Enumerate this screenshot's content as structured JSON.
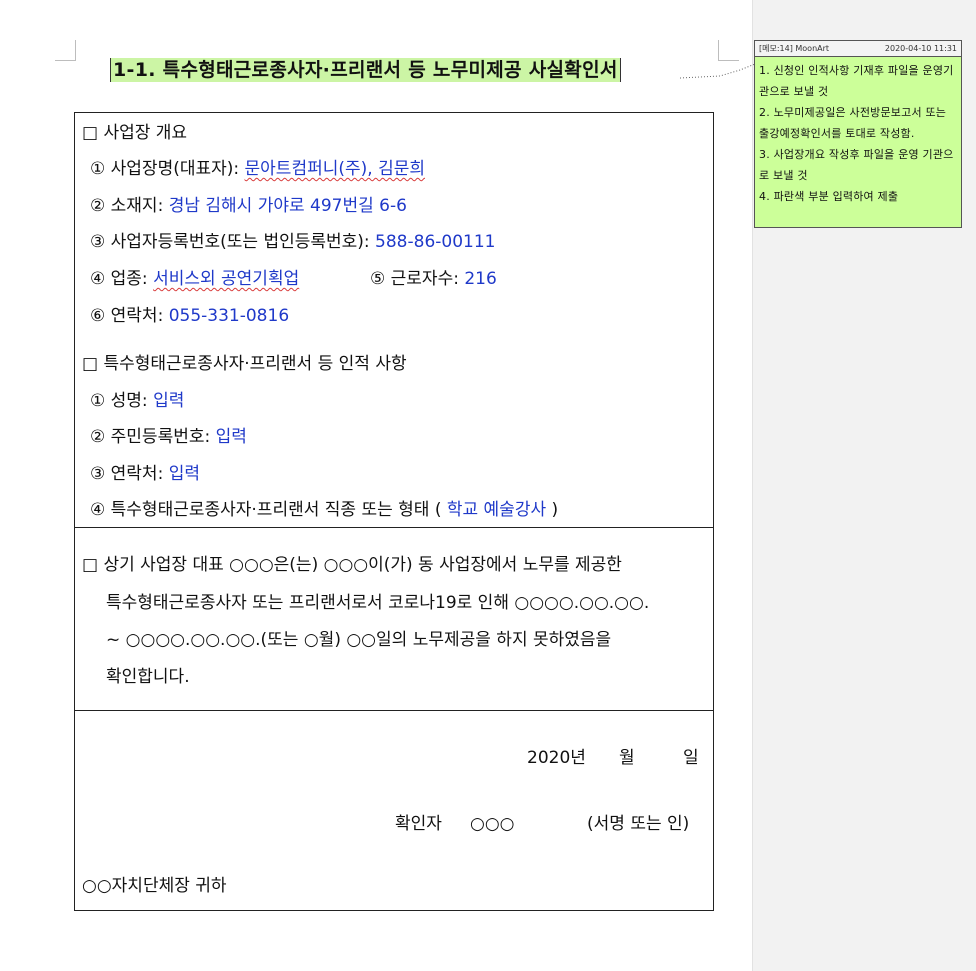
{
  "title": {
    "text": "1-1. 특수형태근로종사자·프리랜서 등 노무미제공 사실확인서"
  },
  "section1": {
    "heading": "□ 사업장 개요",
    "items": [
      {
        "label": "① 사업장명(대표자): ",
        "value": "문아트컴퍼니(주), 김문희"
      },
      {
        "label": "② 소재지: ",
        "value": "경남 김해시 가야로 497번길 6-6"
      },
      {
        "label": "③ 사업자등록번호(또는 법인등록번호): ",
        "value": "588-86-00111"
      },
      {
        "label": "④ 업종: ",
        "value": "서비스외 공연기획업"
      },
      {
        "label": "⑤ 근로자수: ",
        "value": "216"
      },
      {
        "label": "⑥ 연락처: ",
        "value": "055-331-0816"
      }
    ]
  },
  "section2": {
    "heading": "□ 특수형태근로종사자·프리랜서 등 인적 사항",
    "items": [
      {
        "label": "① 성명: ",
        "value": "입력"
      },
      {
        "label": "② 주민등록번호: ",
        "value": "입력"
      },
      {
        "label": "③ 연락처: ",
        "value": "입력"
      },
      {
        "label": "④ 특수형태근로종사자·프리랜서 직종 또는 형태 ( ",
        "value": "학교 예술강사",
        "suffix": " )"
      }
    ]
  },
  "statement": {
    "lines": [
      "□ 상기 사업장 대표 ○○○은(는) ○○○이(가) 동 사업장에서 노무를 제공한",
      "특수형태근로종사자 또는 프리랜서로서 코로나19로 인해 ○○○○.○○.○○.",
      "~ ○○○○.○○.○○.(또는 ○월) ○○일의 노무제공을 하지 못하였음을",
      "확인합니다."
    ]
  },
  "signature": {
    "year": "2020년",
    "month": "월",
    "day": "일",
    "confirmer_label": "확인자",
    "confirmer_name": "○○○",
    "sign_note": "(서명 또는 인)",
    "recipient": "○○자치단체장 귀하"
  },
  "memo": {
    "label": "[메모:14] MoonArt",
    "date": "2020-04-10 11:31",
    "lines": [
      "1. 신청인 인적사항 기재후 파일을 운영기관으로 보낼 것",
      "2. 노무미제공일은 사전방문보고서 또는 출강예정확인서를 토대로 작성함.",
      "3. 사업장개요 작성후 파일을 운영 기관으로 보낼 것",
      "4. 파란색 부분 입력하여 제출"
    ]
  },
  "colors": {
    "input_text": "#1f39c9",
    "title_highlight": "#ccf5a5",
    "memo_background": "#ccff99"
  }
}
